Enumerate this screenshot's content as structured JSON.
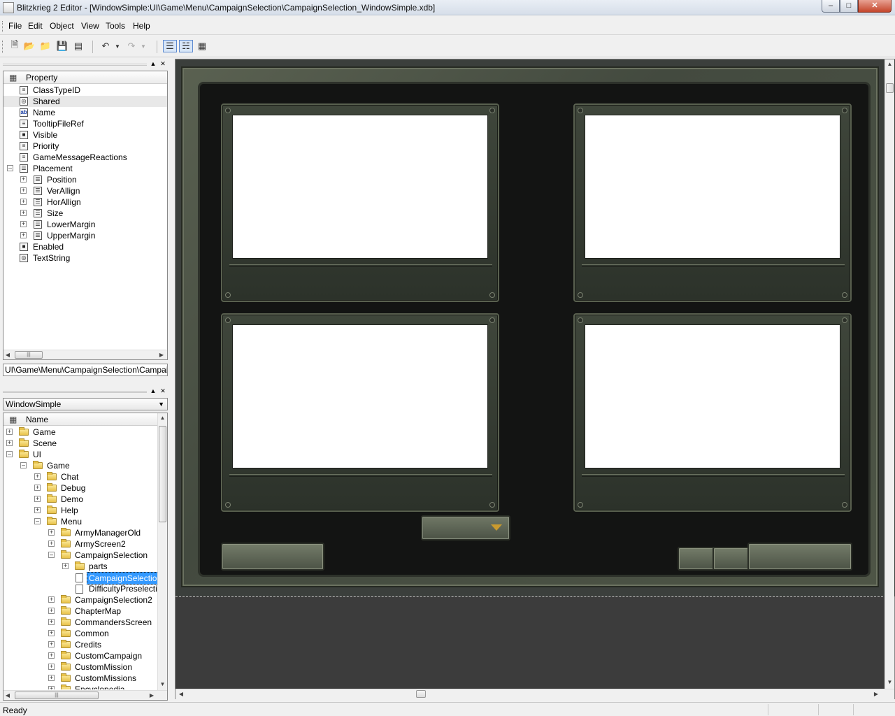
{
  "window": {
    "title": "Blitzkrieg 2 Editor - [WindowSimple:UI\\Game\\Menu\\CampaignSelection\\CampaignSelection_WindowSimple.xdb]",
    "min_label": "–",
    "max_label": "□",
    "close_label": "✕"
  },
  "menu": {
    "file": "File",
    "edit": "Edit",
    "object": "Object",
    "view": "View",
    "tools": "Tools",
    "help": "Help"
  },
  "toolbar": {
    "icons": [
      "new-file-icon",
      "open-folder-icon",
      "open-recent-icon",
      "save-icon",
      "save-all-icon",
      "undo-icon",
      "undo-dropdown-icon",
      "redo-icon",
      "redo-dropdown-icon",
      "property-view-icon",
      "tree-view-icon",
      "table-view-icon"
    ]
  },
  "property_panel": {
    "header": "Property",
    "path": "UI\\Game\\Menu\\CampaignSelection\\CampaignSelection_WindowSimple.xdb",
    "rows": [
      {
        "label": "ClassTypeID",
        "icon": "≡"
      },
      {
        "label": "Shared",
        "icon": "◎"
      },
      {
        "label": "Name",
        "icon": "ab"
      },
      {
        "label": "TooltipFileRef",
        "icon": "≡"
      },
      {
        "label": "Visible",
        "icon": "■"
      },
      {
        "label": "Priority",
        "icon": "≡"
      },
      {
        "label": "GameMessageReactions",
        "icon": "≡"
      },
      {
        "label": "Placement",
        "icon": "☰"
      },
      {
        "label": "Position",
        "icon": "☰"
      },
      {
        "label": "VerAllign",
        "icon": "☰"
      },
      {
        "label": "HorAllign",
        "icon": "☰"
      },
      {
        "label": "Size",
        "icon": "☰"
      },
      {
        "label": "LowerMargin",
        "icon": "☰"
      },
      {
        "label": "UpperMargin",
        "icon": "☰"
      },
      {
        "label": "Enabled",
        "icon": "■"
      },
      {
        "label": "TextString",
        "icon": "◎"
      }
    ]
  },
  "object_panel": {
    "type_selected": "WindowSimple",
    "header": "Name",
    "items": [
      {
        "label": "Game",
        "type": "folder"
      },
      {
        "label": "Scene",
        "type": "folder"
      },
      {
        "label": "UI",
        "type": "folder"
      },
      {
        "label": "Game",
        "type": "folder"
      },
      {
        "label": "Chat",
        "type": "folder"
      },
      {
        "label": "Debug",
        "type": "folder"
      },
      {
        "label": "Demo",
        "type": "folder"
      },
      {
        "label": "Help",
        "type": "folder"
      },
      {
        "label": "Menu",
        "type": "folder"
      },
      {
        "label": "ArmyManagerOld",
        "type": "folder"
      },
      {
        "label": "ArmyScreen2",
        "type": "folder"
      },
      {
        "label": "CampaignSelection",
        "type": "folder"
      },
      {
        "label": "parts",
        "type": "folder"
      },
      {
        "label": "CampaignSelection_WindowSimple.xdb",
        "type": "file"
      },
      {
        "label": "DifficultyPreselection",
        "type": "file"
      },
      {
        "label": "CampaignSelection2",
        "type": "folder"
      },
      {
        "label": "ChapterMap",
        "type": "folder"
      },
      {
        "label": "CommandersScreen",
        "type": "folder"
      },
      {
        "label": "Common",
        "type": "folder"
      },
      {
        "label": "Credits",
        "type": "folder"
      },
      {
        "label": "CustomCampaign",
        "type": "folder"
      },
      {
        "label": "CustomMission",
        "type": "folder"
      },
      {
        "label": "CustomMissions",
        "type": "folder"
      },
      {
        "label": "Encyclopedia",
        "type": "folder"
      }
    ]
  },
  "status": {
    "text": "Ready"
  },
  "colors": {
    "selection": "#3399ff",
    "game_frame": "#4e5546",
    "game_inner": "#131413",
    "dropdown_arrow": "#c99a2e"
  }
}
